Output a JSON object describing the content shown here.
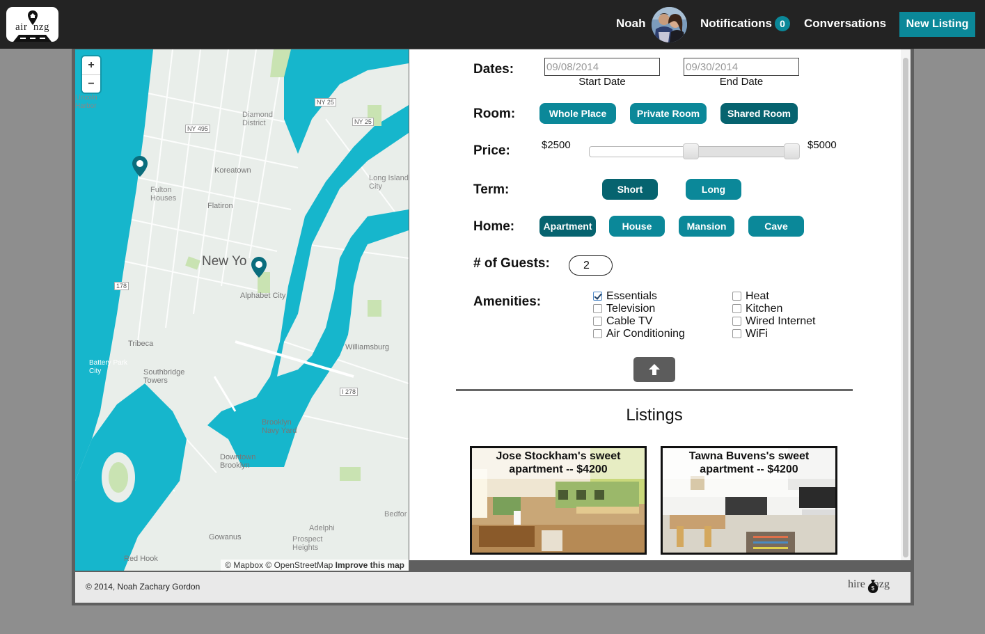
{
  "header": {
    "logo_text": "air  nzg",
    "user_name": "Noah",
    "notifications_label": "Notifications",
    "notifications_count": "0",
    "conversations_label": "Conversations",
    "new_listing_label": "New Listing"
  },
  "map": {
    "zoom_in": "+",
    "zoom_out": "−",
    "attribution_prefix": "© Mapbox © OpenStreetMap",
    "attribution_link": "Improve this map",
    "labels": {
      "new_york": "New Yo",
      "koreatown": "Koreatown",
      "fulton_houses": "Fulton\nHouses",
      "flatiron": "Flatiron",
      "alphabet_city": "Alphabet City",
      "long_island_city": "Long Island\nCity",
      "williamsburg": "Williamsburg",
      "tribeca": "Tribeca",
      "battery_park_city": "Battery Park\nCity",
      "southbridge_towers": "Southbridge\nTowers",
      "brooklyn_navy_yard": "Brooklyn\nNavy Yard",
      "downtown_brooklyn": "Downtown\nBrooklyn",
      "gowanus": "Gowanus",
      "red_hook": "Red Hook",
      "prospect_heights": "Prospect\nHeights",
      "adelphi": "Adelphi",
      "diamond_district": "Diamond\nDistrict",
      "lincoln_harbor": "Lincoln\nHarbor",
      "bedford": "Bedfor",
      "ny495": "NY 495",
      "ny25": "NY 25",
      "i278": "I 278",
      "r178": "178"
    },
    "colors": {
      "water": "#16b6cc",
      "land": "#e9eeea",
      "park": "#c9e3b2",
      "pin": "#0a6d7d"
    }
  },
  "filters": {
    "dates_label": "Dates:",
    "start_date_value": "09/08/2014",
    "start_date_caption": "Start Date",
    "end_date_value": "09/30/2014",
    "end_date_caption": "End Date",
    "room_label": "Room:",
    "room_options": [
      "Whole Place",
      "Private Room",
      "Shared Room"
    ],
    "room_selected": "Shared Room",
    "price_label": "Price:",
    "price_min": "$2500",
    "price_max": "$5000",
    "term_label": "Term:",
    "term_options": [
      "Short",
      "Long"
    ],
    "term_selected": "Short",
    "home_label": "Home:",
    "home_options": [
      "Apartment",
      "House",
      "Mansion",
      "Cave"
    ],
    "home_selected": "Apartment",
    "guests_label": "# of Guests:",
    "guests_value": "2",
    "amenities_label": "Amenities:",
    "amenities_col1": [
      {
        "label": "Essentials",
        "checked": true
      },
      {
        "label": "Television",
        "checked": false
      },
      {
        "label": "Cable TV",
        "checked": false
      },
      {
        "label": "Air Conditioning",
        "checked": false
      }
    ],
    "amenities_col2": [
      {
        "label": "Heat",
        "checked": false
      },
      {
        "label": "Kitchen",
        "checked": false
      },
      {
        "label": "Wired Internet",
        "checked": false
      },
      {
        "label": "WiFi",
        "checked": false
      }
    ],
    "collapse_icon": "arrow-up-icon"
  },
  "listings": {
    "title": "Listings",
    "items": [
      {
        "title": "Jose Stockham's sweet apartment -- $4200"
      },
      {
        "title": "Tawna Buvens's sweet apartment -- $4200"
      }
    ]
  },
  "footer": {
    "copyright": "© 2014, Noah Zachary Gordon",
    "hire_logo": "hire   nzg"
  },
  "colors": {
    "accent": "#0b8899",
    "accent_dark": "#06636f",
    "nav_bg": "#232323"
  }
}
